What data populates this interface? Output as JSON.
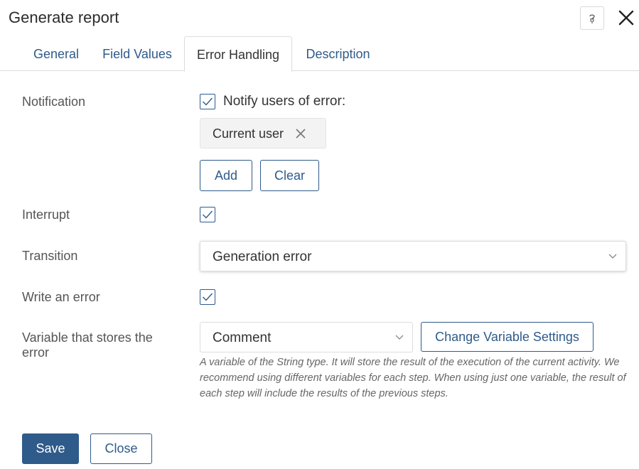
{
  "dialog": {
    "title": "Generate report"
  },
  "tabs": [
    {
      "label": "General"
    },
    {
      "label": "Field Values"
    },
    {
      "label": "Error Handling"
    },
    {
      "label": "Description"
    }
  ],
  "notification": {
    "label": "Notification",
    "checkbox_label": "Notify users of error:",
    "checked": true,
    "chip_label": "Current user",
    "add_label": "Add",
    "clear_label": "Clear"
  },
  "interrupt": {
    "label": "Interrupt",
    "checked": true
  },
  "transition": {
    "label": "Transition",
    "value": "Generation error"
  },
  "write_error": {
    "label": "Write an error",
    "checked": true
  },
  "variable": {
    "label_line1": "Variable that stores the",
    "label_line2": "error",
    "value": "Comment",
    "settings_label": "Change Variable Settings",
    "hint": "A variable of the String type. It will store the result of the execution of the current activity. We recommend using different variables for each step. When using just one variable, the result of each step will include the results of the previous steps."
  },
  "footer": {
    "save_label": "Save",
    "close_label": "Close"
  },
  "colors": {
    "accent": "#2f5b8a",
    "text": "#333333",
    "border": "#dcdcdc"
  }
}
